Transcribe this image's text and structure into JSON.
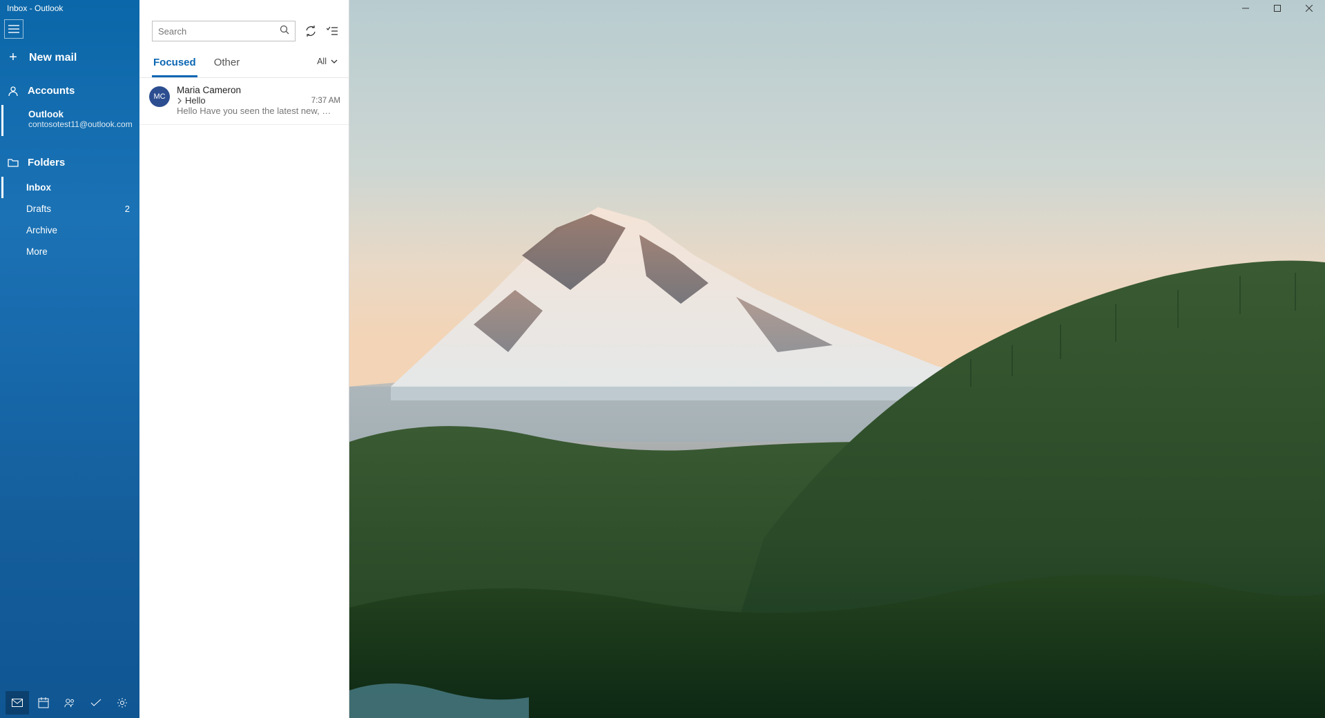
{
  "window": {
    "title": "Inbox - Outlook"
  },
  "sidebar": {
    "new_mail": "New mail",
    "accounts_label": "Accounts",
    "account_name": "Outlook",
    "account_email": "contosotest11@outlook.com",
    "folders_label": "Folders",
    "folders": [
      {
        "label": "Inbox",
        "count": ""
      },
      {
        "label": "Drafts",
        "count": "2"
      },
      {
        "label": "Archive",
        "count": ""
      },
      {
        "label": "More",
        "count": ""
      }
    ]
  },
  "list": {
    "search_placeholder": "Search",
    "tab_focused": "Focused",
    "tab_other": "Other",
    "filter_label": "All",
    "emails": [
      {
        "initials": "MC",
        "from": "Maria Cameron",
        "subject": "Hello",
        "time": "7:37 AM",
        "preview": "Hello Have you seen the latest new, …"
      }
    ]
  }
}
